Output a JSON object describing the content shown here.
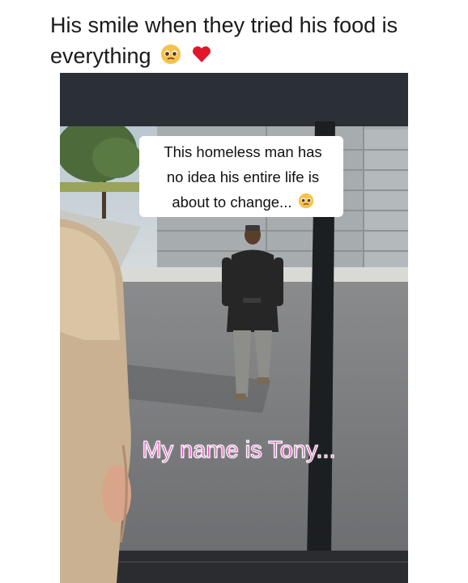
{
  "post": {
    "caption_line1": "His smile when they tried his food is",
    "caption_line2": "everything",
    "caption_emojis": [
      "pleading-face-emoji",
      "red-heart-emoji"
    ]
  },
  "video": {
    "overlay_lines": [
      "This homeless man has",
      "no idea his entire life is",
      "about to change..."
    ],
    "overlay_emoji": "pleading-face-emoji",
    "subtitle": "My name is Tony..."
  },
  "colors": {
    "subtitle_pink": "#e24fb8",
    "heart_red": "#e0162b",
    "emoji_yellow": "#f6c24a"
  }
}
